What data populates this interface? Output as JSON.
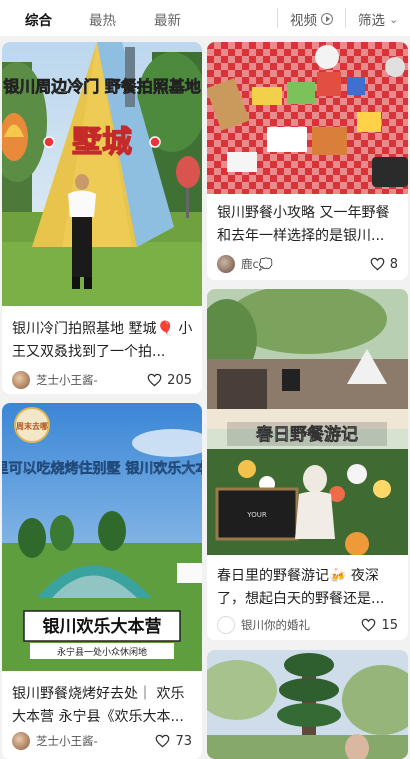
{
  "tabs": {
    "all": "综合",
    "hot": "最热",
    "new": "最新"
  },
  "filters": {
    "video": "视频",
    "screen": "筛选"
  },
  "cards": [
    {
      "overlay_title": "银川周边冷门 野餐拍照基地",
      "overlay_tag": "墅城",
      "title": "银川冷门拍照基地 墅城🎈 小王又双叒找到了一个拍...",
      "author": "芝士小王酱-",
      "likes": "205"
    },
    {
      "overlay_title": "这里可以吃烧烤住别墅 银川欢乐大本营",
      "overlay_badge": "周末去哪",
      "overlay_banner": "银川欢乐大本营",
      "overlay_sub": "永宁县一处小众休闲地",
      "title": "银川野餐烧烤好去处｜ 欢乐大本营 永宁县《欢乐大本...",
      "author": "芝士小王酱-",
      "likes": "73"
    },
    {
      "title": "银川野餐小攻略 又一年野餐和去年一样选择的是银川...",
      "author": "鹿c💭",
      "likes": "8"
    },
    {
      "overlay_title": "春日野餐游记",
      "title": "春日里的野餐游记🍻 夜深了，想起白天的野餐还是...",
      "author": "银川你的婚礼",
      "likes": "15"
    },
    {
      "title": ""
    }
  ],
  "colors": {
    "accent_red": "#e8343a",
    "text_dark": "#222222",
    "background": "#f2f2f2"
  }
}
